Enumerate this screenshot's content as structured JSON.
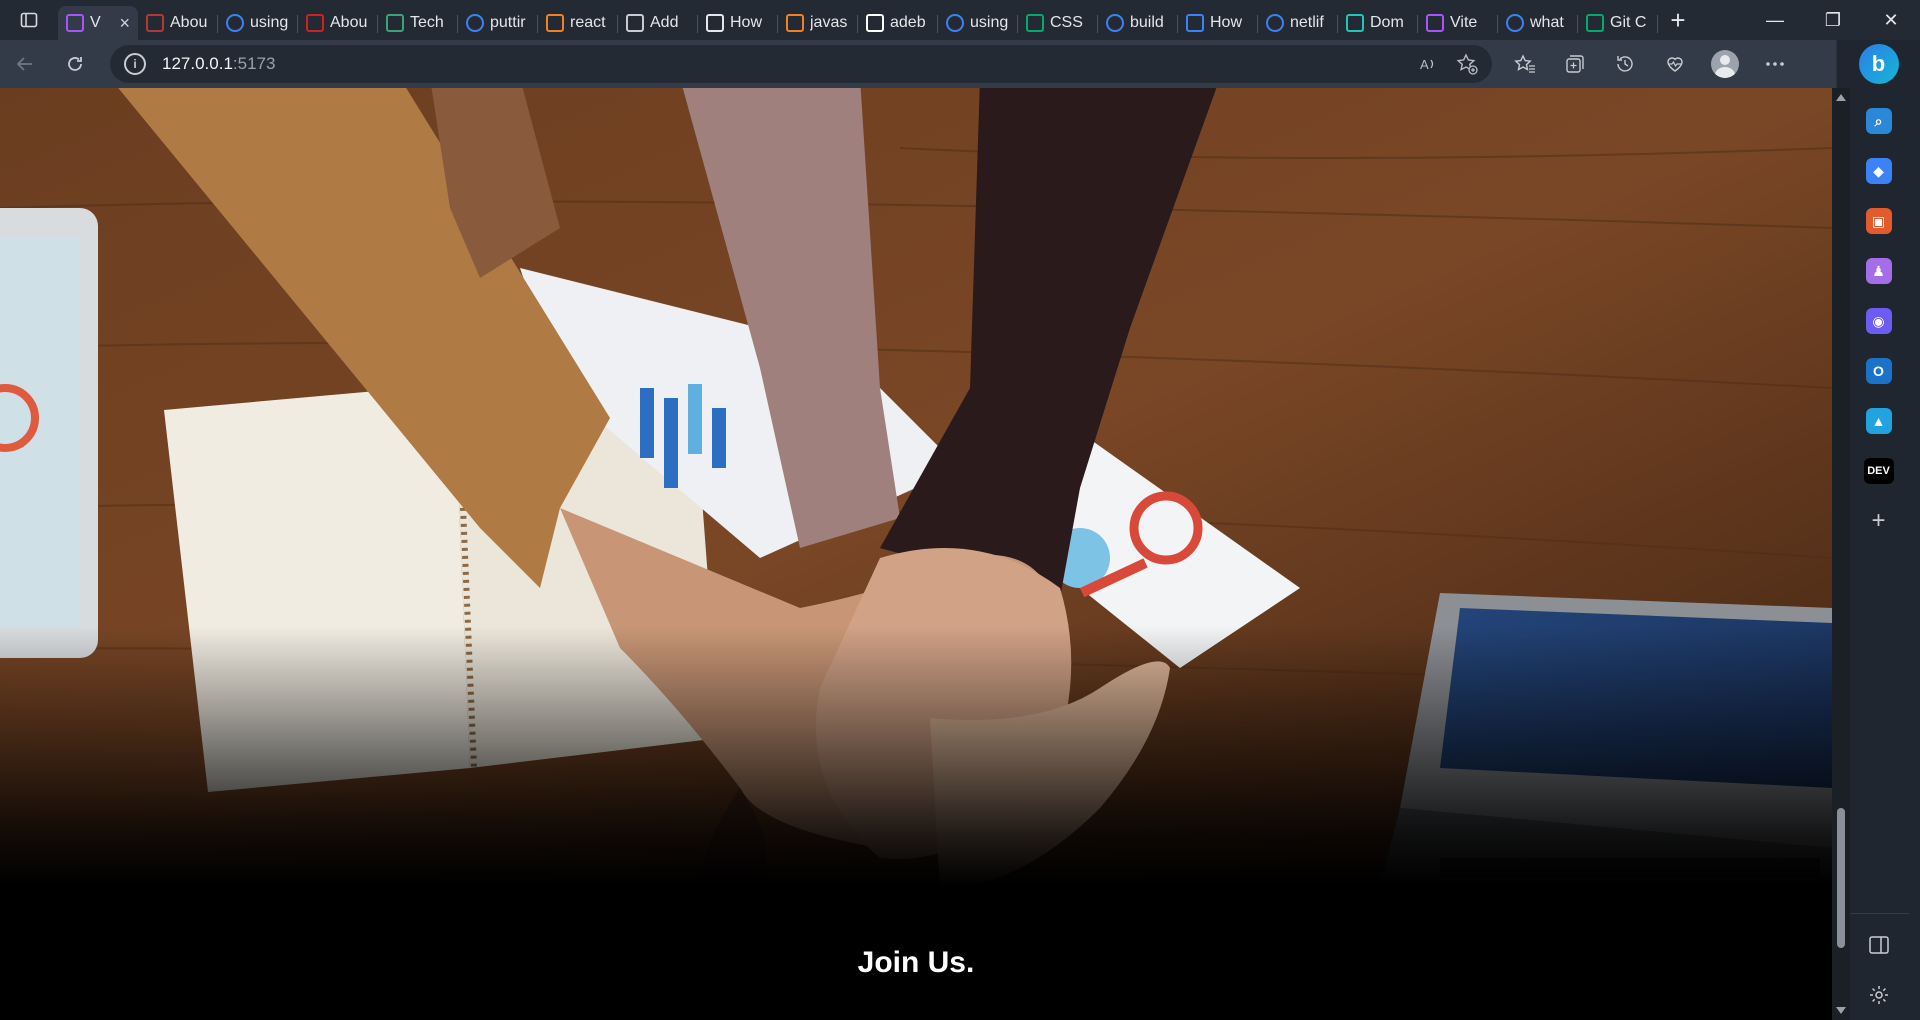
{
  "browser": {
    "tabs": [
      {
        "title": "V",
        "favicon": "vite-logo",
        "favicon_color": "#a855f7",
        "active": true
      },
      {
        "title": "Abou",
        "favicon": "pdf-icon",
        "favicon_color": "#b03a3a"
      },
      {
        "title": "using",
        "favicon": "search-icon",
        "favicon_color": "#3b82f6"
      },
      {
        "title": "Abou",
        "favicon": "tesla-logo",
        "favicon_color": "#cc2222"
      },
      {
        "title": "Tech",
        "favicon": "site-icon",
        "favicon_color": "#3aa37a"
      },
      {
        "title": "puttir",
        "favicon": "search-icon",
        "favicon_color": "#3b82f6"
      },
      {
        "title": "react",
        "favicon": "stackoverflow-icon",
        "favicon_color": "#f48024"
      },
      {
        "title": "Add",
        "favicon": "video-icon",
        "favicon_color": "#c8ccd2"
      },
      {
        "title": "How",
        "favicon": "medium-icon",
        "favicon_color": "#e3e6ea"
      },
      {
        "title": "javas",
        "favicon": "stackoverflow-icon",
        "favicon_color": "#f48024"
      },
      {
        "title": "adeb",
        "favicon": "github-icon",
        "favicon_color": "#ffffff"
      },
      {
        "title": "using",
        "favicon": "search-icon",
        "favicon_color": "#3b82f6"
      },
      {
        "title": "CSS",
        "favicon": "w3schools-icon",
        "favicon_color": "#04aa6d"
      },
      {
        "title": "build",
        "favicon": "search-icon",
        "favicon_color": "#3b82f6"
      },
      {
        "title": "How",
        "favicon": "netlify-loader-icon",
        "favicon_color": "#3b82f6"
      },
      {
        "title": "netlif",
        "favicon": "search-icon",
        "favicon_color": "#3b82f6"
      },
      {
        "title": "Dom",
        "favicon": "netlify-icon",
        "favicon_color": "#20c6b7"
      },
      {
        "title": "Vite",
        "favicon": "vite-logo",
        "favicon_color": "#a855f7"
      },
      {
        "title": "what",
        "favicon": "search-icon",
        "favicon_color": "#3b82f6"
      },
      {
        "title": "Git C",
        "favicon": "w3schools-icon",
        "favicon_color": "#04aa6d"
      }
    ],
    "close_tab": "×",
    "new_tab": "+",
    "address": {
      "host": "127.0.0.1",
      "port": ":5173",
      "info": "i"
    },
    "window": {
      "minimize": "—",
      "maximize": "❐",
      "close": "✕"
    }
  },
  "sidebar": {
    "copilot": "b",
    "items": [
      {
        "name": "search",
        "label": "⌕",
        "color": "#2b88d8"
      },
      {
        "name": "shopping",
        "label": "◆",
        "color": "#3b82f6"
      },
      {
        "name": "tools",
        "label": "▣",
        "color": "#e25b2c"
      },
      {
        "name": "games",
        "label": "♟",
        "color": "#a56ee8"
      },
      {
        "name": "microsoft365",
        "label": "◉",
        "color": "#6b5cf2"
      },
      {
        "name": "outlook",
        "label": "O",
        "color": "#1a73c8"
      },
      {
        "name": "drop",
        "label": "▲",
        "color": "#22a3e0"
      },
      {
        "name": "dev",
        "label": "DEV",
        "color": "#000000"
      },
      {
        "name": "add",
        "label": "+",
        "color": "transparent"
      }
    ]
  },
  "page": {
    "hero_image_alt": "hands-stacked-teamwork-photo",
    "heading": "Join Us."
  }
}
